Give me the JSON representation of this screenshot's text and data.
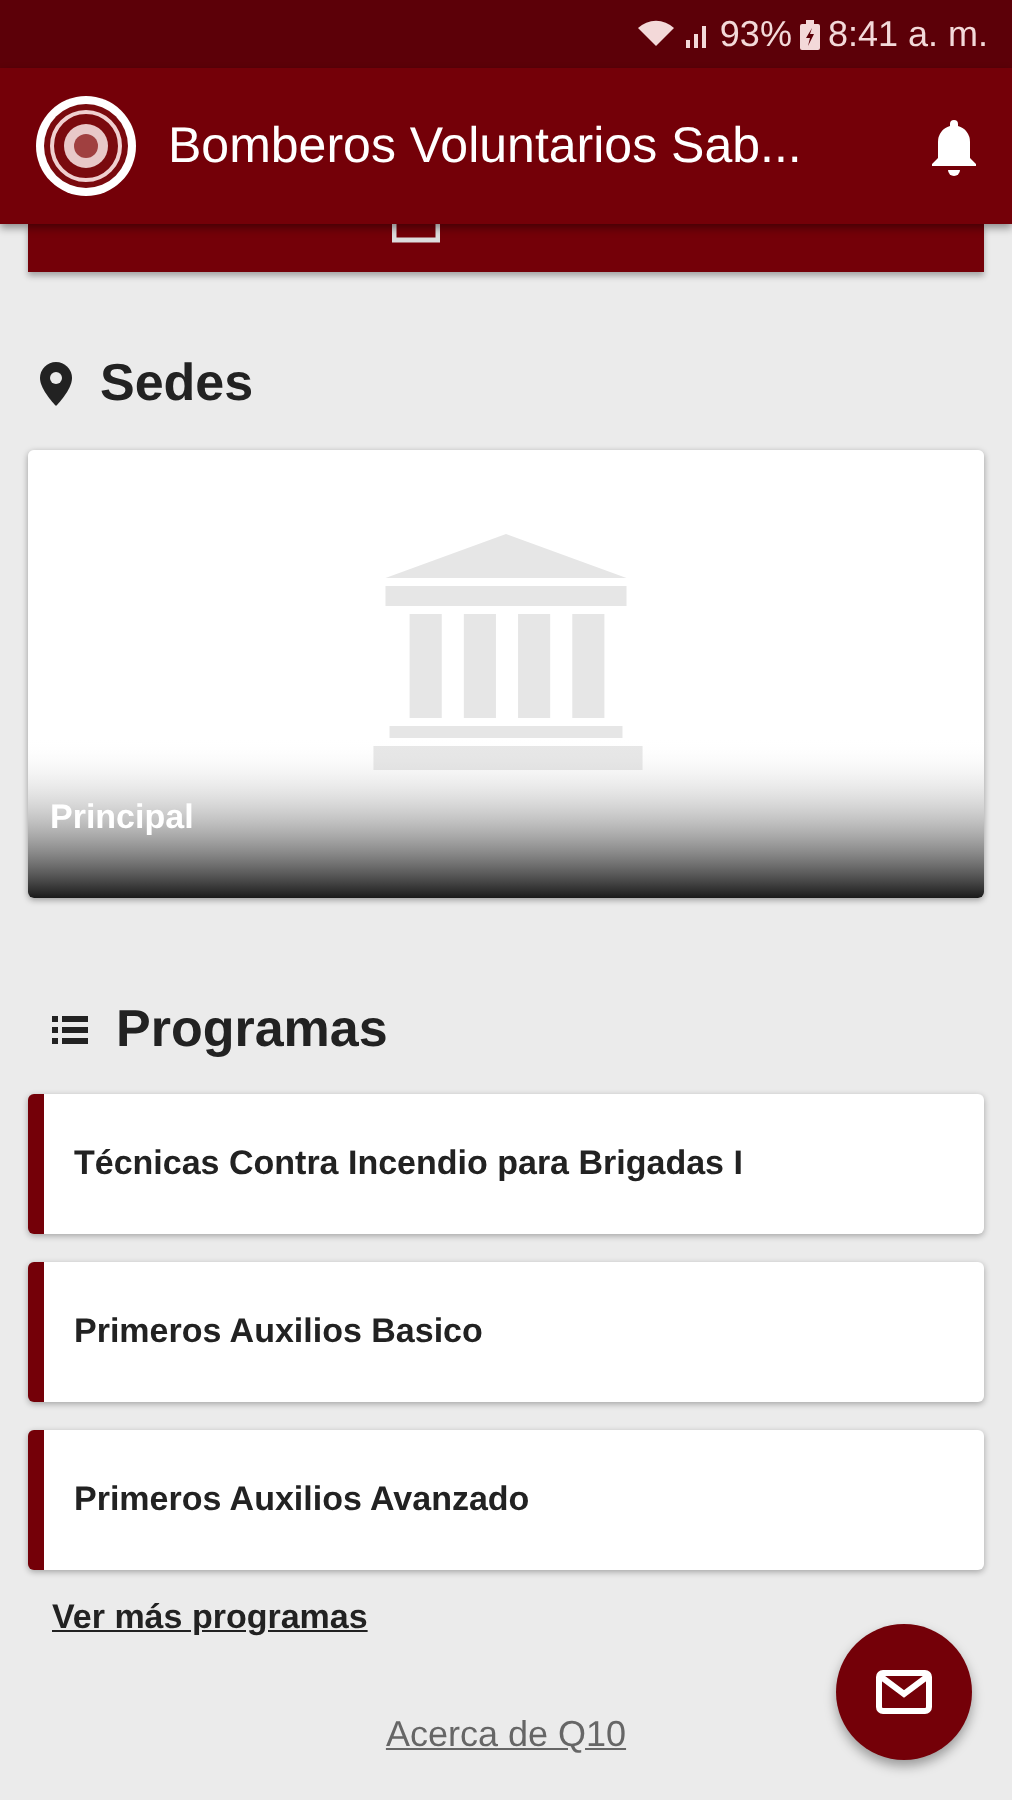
{
  "status_bar": {
    "battery": "93%",
    "time": "8:41 a. m."
  },
  "app_bar": {
    "title": "Bomberos Voluntarios Sab..."
  },
  "sedes": {
    "title": "Sedes",
    "items": [
      {
        "name": "Principal",
        "kind": "picture"
      }
    ]
  },
  "programas": {
    "title": "Programas",
    "items": [
      {
        "name": "Técnicas Contra Incendio para Brigadas I"
      },
      {
        "name": "Primeros Auxilios Basico"
      },
      {
        "name": "Primeros Auxilios Avanzado"
      }
    ],
    "more_link": "Ver más programas"
  },
  "footer_link": "Acerca de Q10"
}
